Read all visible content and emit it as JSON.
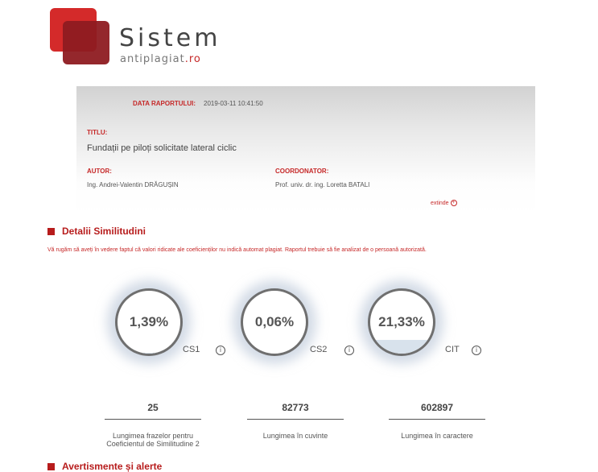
{
  "logo": {
    "main": "Sistem",
    "sub_a": "anti",
    "sub_b": "plagiat",
    "sub_c": ".ro"
  },
  "report": {
    "date_label": "DATA RAPORTULUI:",
    "date_value": "2019-03-11 10:41:50",
    "title_label": "TITLU:",
    "title_value": "Fundații pe piloți solicitate lateral ciclic",
    "author_label": "AUTOR:",
    "author_value": "Ing. Andrei-Valentin DRĂGUȘIN",
    "coord_label": "COORDONATOR:",
    "coord_value": "Prof. univ. dr. ing. Loretta BATALI",
    "extend_label": "extinde"
  },
  "similarity": {
    "title": "Detalii Similitudini",
    "notice": "Vă rugăm să aveți în vedere faptul că valori ridicate ale coeficienților nu indică automat plagiat. Raportul trebuie să fie analizat de o persoană autorizată.",
    "gauges": [
      {
        "value": "1,39%",
        "label": "CS1",
        "fill": 0.0139
      },
      {
        "value": "0,06%",
        "label": "CS2",
        "fill": 0.0006
      },
      {
        "value": "21,33%",
        "label": "CIT",
        "fill": 0.2133
      }
    ],
    "stats": [
      {
        "value": "25",
        "caption_1": "Lungimea frazelor pentru",
        "caption_2": "Coeficientul de Similitudine 2"
      },
      {
        "value": "82773",
        "caption_1": "Lungimea în cuvinte",
        "caption_2": ""
      },
      {
        "value": "602897",
        "caption_1": "Lungimea în caractere",
        "caption_2": ""
      }
    ]
  },
  "alerts": {
    "title": "Avertismente și alerte"
  },
  "colors": {
    "accent": "#c62828",
    "dark_red": "#8e1b21"
  }
}
